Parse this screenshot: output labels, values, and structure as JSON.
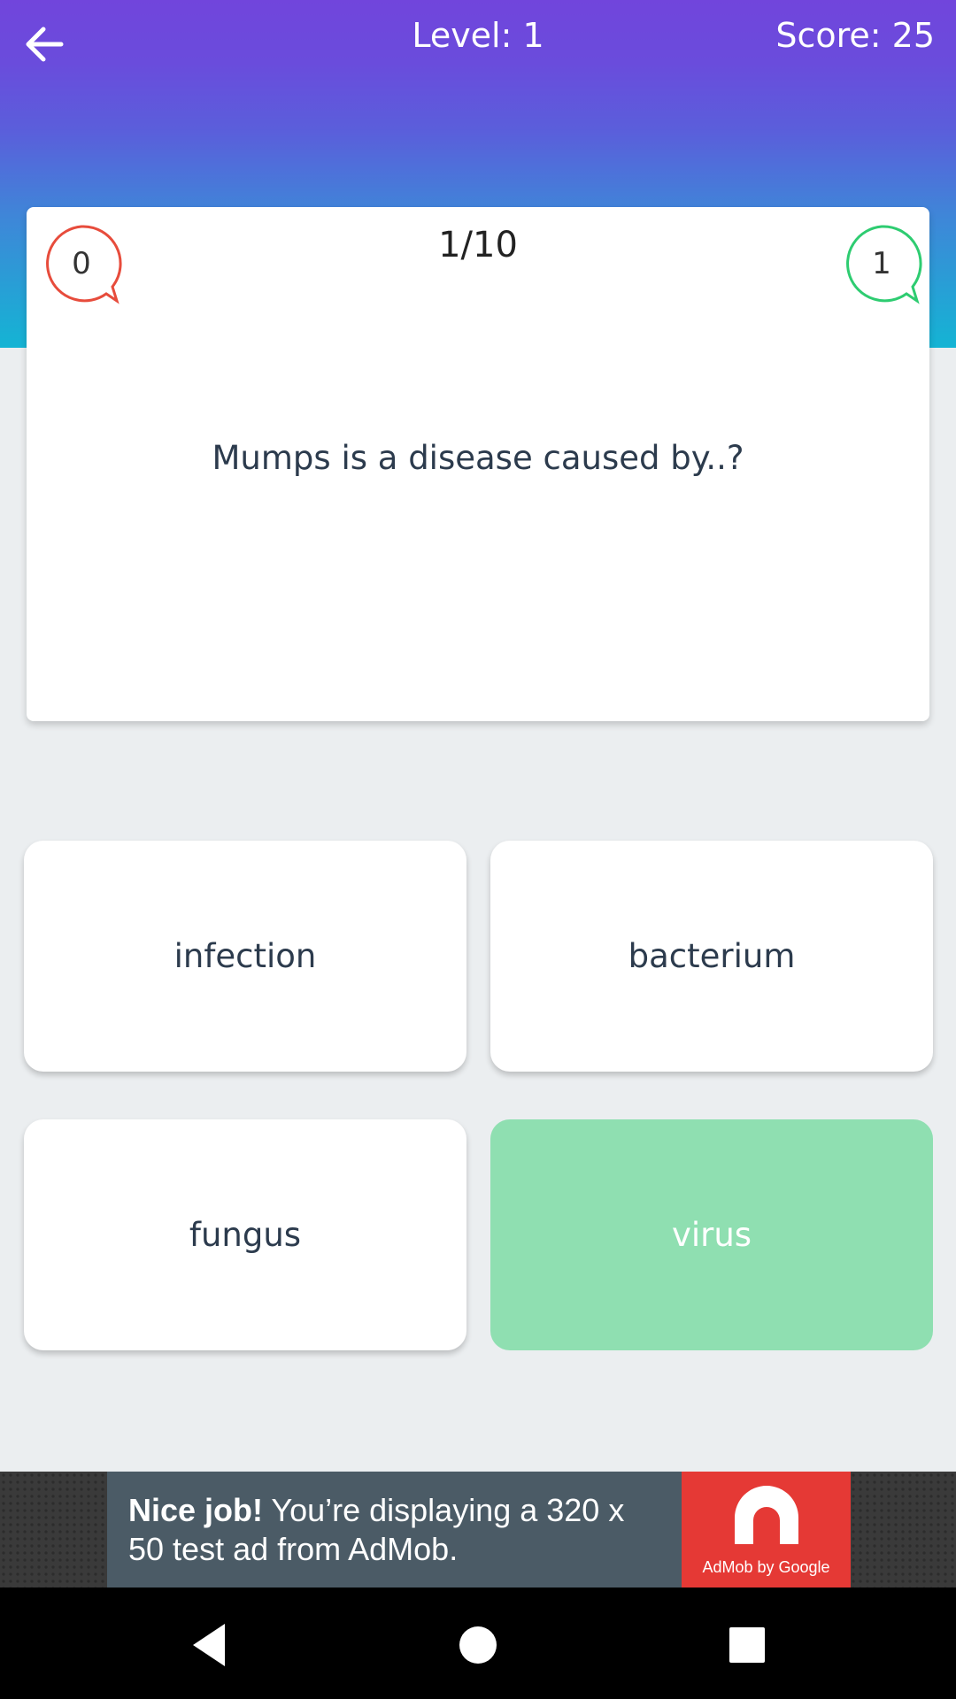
{
  "header": {
    "back_icon": "arrow-left-icon",
    "level": "Level: 1",
    "score": "Score: 25"
  },
  "question": {
    "counter": "1/10",
    "wrong_count": "0",
    "right_count": "1",
    "text": "Mumps is a disease caused by..?"
  },
  "answers": [
    {
      "label": "infection",
      "state": "default"
    },
    {
      "label": "bacterium",
      "state": "default"
    },
    {
      "label": "fungus",
      "state": "default"
    },
    {
      "label": "virus",
      "state": "correct"
    }
  ],
  "ad": {
    "bold": "Nice job!",
    "text": " You’re displaying a 320 x 50 test ad from AdMob.",
    "logo_caption": "AdMob by Google"
  },
  "nav": {
    "back_icon": "triangle-back-icon",
    "home_icon": "circle-home-icon",
    "recent_icon": "square-recents-icon"
  },
  "colors": {
    "header_top": "#7145dc",
    "header_bottom": "#14b4d4",
    "wrong_ring": "#e74c3c",
    "right_ring": "#2ecc71",
    "correct_answer": "#8fdfb1",
    "ad_red": "#e53935"
  }
}
